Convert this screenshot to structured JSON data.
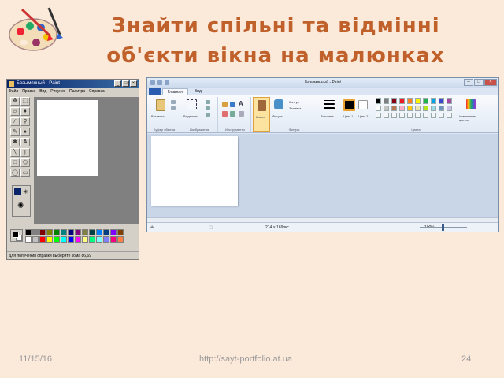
{
  "slide": {
    "title_line1": "Знайти спільні та відмінні",
    "title_line2": "об'єкти вікна на малюнках",
    "footer_date": "11/15/16",
    "footer_url": "http://sayt-portfolio.at.ua",
    "page_number": "24"
  },
  "xp_paint": {
    "title": "Безымянный - Paint",
    "menu": [
      "Файл",
      "Правка",
      "Вид",
      "Рисунок",
      "Палитра",
      "Справка"
    ],
    "status": "Для получения справки выберите кома 86,69",
    "palette": [
      "#000000",
      "#808080",
      "#800000",
      "#808000",
      "#008000",
      "#008080",
      "#000080",
      "#800080",
      "#808040",
      "#004040",
      "#0080ff",
      "#004080",
      "#8000ff",
      "#804000",
      "#ffffff",
      "#c0c0c0",
      "#ff0000",
      "#ffff00",
      "#00ff00",
      "#00ffff",
      "#0000ff",
      "#ff00ff",
      "#ffff80",
      "#00ff80",
      "#80ffff",
      "#8080ff",
      "#ff0080",
      "#ff8040"
    ]
  },
  "w7_paint": {
    "title": "Безымянный - Paint",
    "tabs": [
      "",
      "Главная",
      "Вид"
    ],
    "groups": [
      "Буфер обмена",
      "Изображение",
      "Инструменты",
      "Фигуры",
      "Цвета"
    ],
    "buttons": {
      "paste": "Вставить",
      "select": "Выделить",
      "brushes": "Кисти",
      "shapes": "Фигуры",
      "outline": "Контур",
      "fill": "Заливка",
      "thickness": "Толщина",
      "color1": "Цвет 1",
      "color2": "Цвет 2",
      "edit_colors": "Изменение цветов"
    },
    "status_size": "214 × 169пкс",
    "zoom": "100%",
    "palette": [
      "#000000",
      "#7f7f7f",
      "#880015",
      "#ed1c24",
      "#ff7f27",
      "#fff200",
      "#22b14c",
      "#00a2e8",
      "#3f48cc",
      "#a349a4",
      "#ffffff",
      "#c3c3c3",
      "#b97a57",
      "#ffaec9",
      "#ffc90e",
      "#efe4b0",
      "#b5e61d",
      "#99d9ea",
      "#7092be",
      "#c8bfe7"
    ]
  }
}
